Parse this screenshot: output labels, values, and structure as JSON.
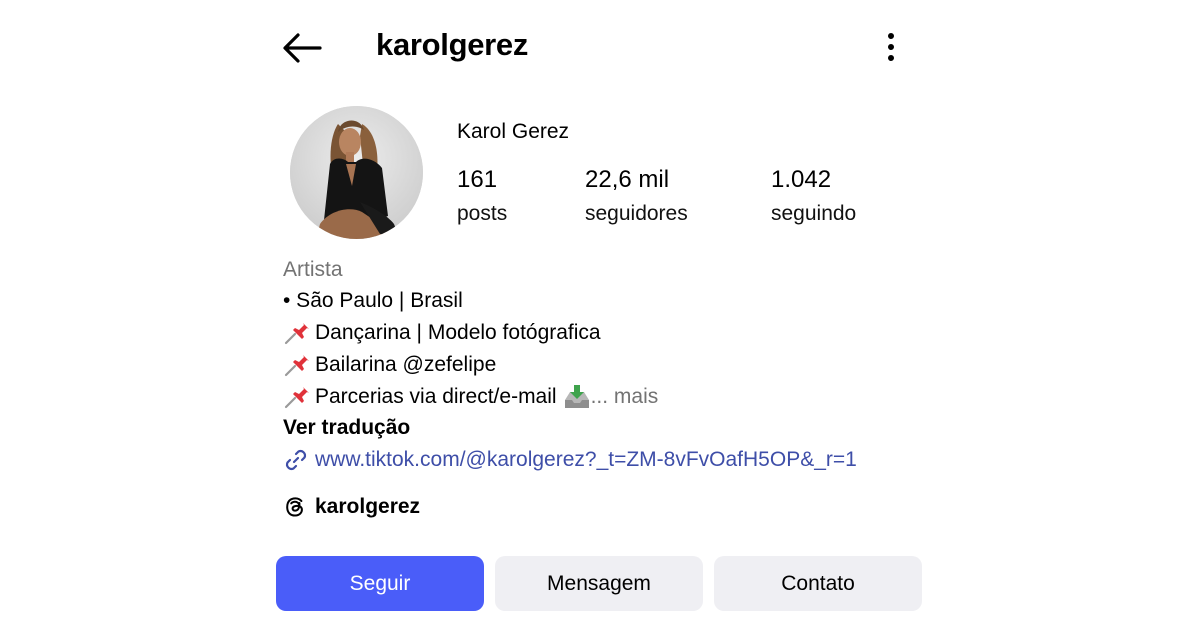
{
  "header": {
    "username": "karolgerez",
    "back_icon": "arrow-left-icon",
    "menu_icon": "more-vertical-icon"
  },
  "profile": {
    "full_name": "Karol Gerez",
    "stats": {
      "posts": {
        "value": "161",
        "label": "posts"
      },
      "followers": {
        "value": "22,6 mil",
        "label": "seguidores"
      },
      "following": {
        "value": "1.042",
        "label": "seguindo"
      }
    }
  },
  "bio": {
    "category": "Artista",
    "lines": [
      "• São Paulo | Brasil",
      "Dançarina | Modelo fotógrafica",
      "Bailarina @zefelipe",
      "Parcerias via direct/e-mail "
    ],
    "more_label": "... mais",
    "translate_label": "Ver tradução",
    "link": "www.tiktok.com/@karolgerez?_t=ZM-8vFvOafH5OP&_r=1",
    "threads_handle": "karolgerez"
  },
  "actions": {
    "follow": "Seguir",
    "message": "Mensagem",
    "contact": "Contato"
  },
  "colors": {
    "primary_button": "#4a5df9",
    "secondary_button": "#efeff3",
    "link": "#3e4ea8",
    "muted_text": "#737373"
  }
}
